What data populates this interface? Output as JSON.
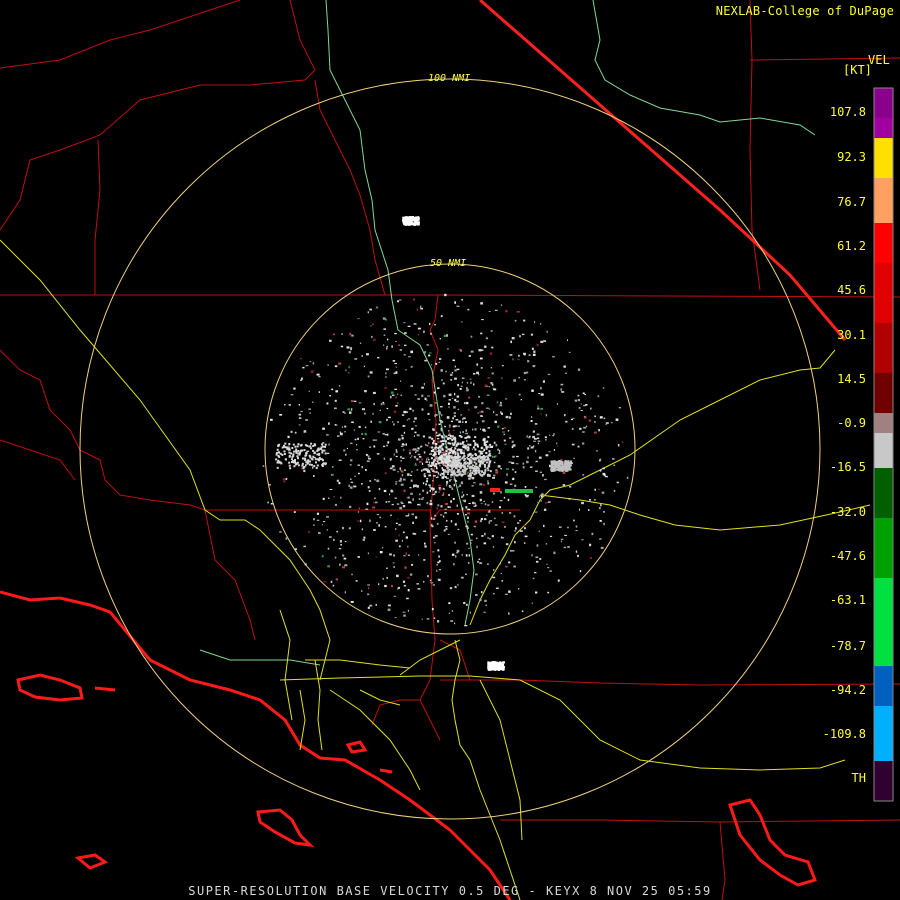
{
  "credit": "NEXLAB-College of DuPage",
  "legend": {
    "title": "VEL",
    "unit": "[KT]",
    "labels": [
      "107.8",
      "92.3",
      "76.7",
      "61.2",
      "45.6",
      "30.1",
      "14.5",
      "-0.9",
      "-16.5",
      "-32.0",
      "-47.6",
      "-63.1",
      "-78.7",
      "-94.2",
      "-109.8",
      "TH"
    ]
  },
  "rings": [
    {
      "label": "100 NMI"
    },
    {
      "label": "50 NMI"
    }
  ],
  "footer": "SUPER-RESOLUTION BASE VELOCITY 0.5 DEG - KEYX 8 NOV 25 05:59",
  "colors": {
    "county": "#cc1111",
    "state": "#ff2020",
    "coast": "#ff2020",
    "highway": "#e8e830",
    "river": "#80e090",
    "ring": "#f0d080",
    "legend_text": "#ffff33"
  }
}
